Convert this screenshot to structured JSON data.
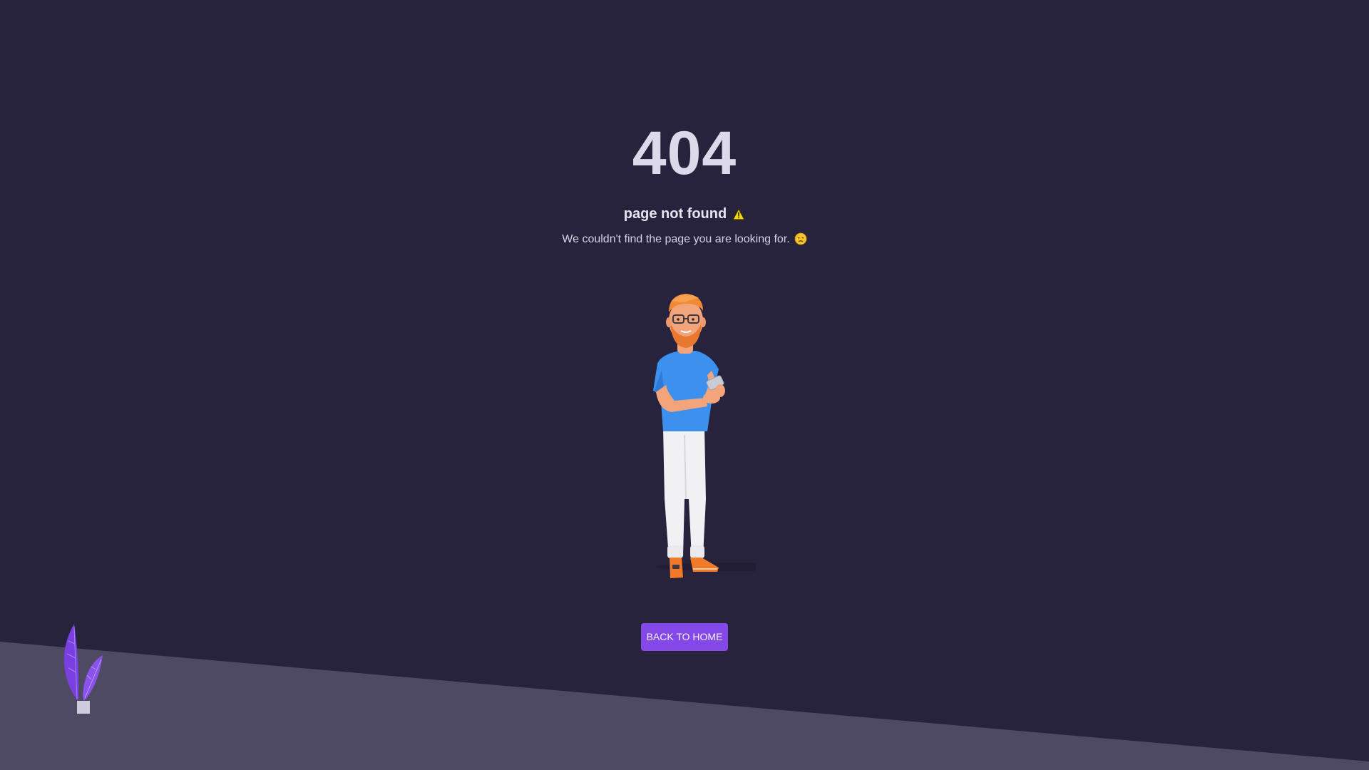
{
  "error": {
    "code": "404",
    "headline": "page not found",
    "message": "We couldn't find the page you are looking for."
  },
  "actions": {
    "home_label": "BACK TO HOME"
  },
  "icons": {
    "warning": "warning-icon",
    "sad_face": "sad-face-icon",
    "illustration": "person-with-phone-illustration",
    "plant": "plant-decoration"
  },
  "colors": {
    "background": "#27233c",
    "floor": "#4e4a64",
    "accent": "#8548e8",
    "heading_text": "#dcd9ea"
  }
}
